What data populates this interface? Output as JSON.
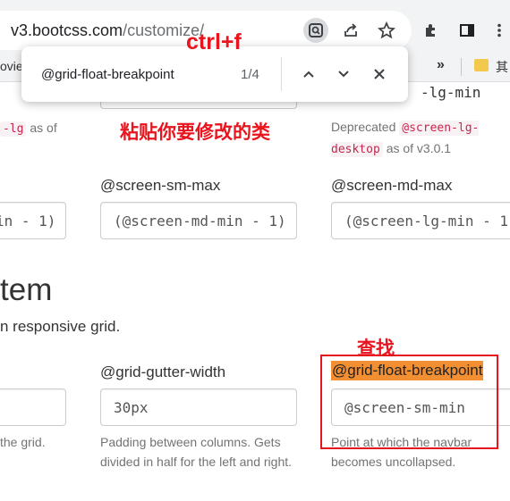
{
  "browser": {
    "url_host": "v3.bootcss.com",
    "url_path": "/customize/",
    "bookmarks_left": "ovie",
    "bookmarks_more": "»",
    "bookmark_folder": "其"
  },
  "findbar": {
    "query": "@grid-float-breakpoint",
    "count": "1/4"
  },
  "annotations": {
    "shortcut": "ctrl+f",
    "paste": "粘贴你要修改的类",
    "search": "查找"
  },
  "page": {
    "top_row": {
      "col1_help_code": "-lg",
      "col1_help_text": "as of",
      "col3_label_partial": "-lg-min",
      "col3_help_prefix": "Deprecated",
      "col3_help_code": "@screen-lg-desktop",
      "col3_help_suffix": "as of v3.0.1"
    },
    "screen_row": {
      "col1_value": "in - 1)",
      "col2_label": "@screen-sm-max",
      "col2_value": "(@screen-md-min - 1)",
      "col3_label": "@screen-md-max",
      "col3_value": "(@screen-lg-min - 1)"
    },
    "section_title": "tem",
    "section_lead": "n responsive grid.",
    "grid_row": {
      "col1_help": "the grid.",
      "col2_label": "@grid-gutter-width",
      "col2_value": "30px",
      "col2_help": "Padding between columns. Gets divided in half for the left and right.",
      "col3_label": "@grid-float-breakpoint",
      "col3_value": "@screen-sm-min",
      "col3_help": "Point at which the navbar becomes uncollapsed."
    }
  },
  "colors": {
    "annotation_red": "#e8141e",
    "find_highlight": "#f28f33",
    "code_pink": "#c7254e"
  },
  "icons": [
    "search-page-icon",
    "share-icon",
    "bookmark-star-icon",
    "extensions-icon",
    "sidepanel-icon",
    "menu-icon",
    "chevron-up-icon",
    "chevron-down-icon",
    "close-icon",
    "folder-icon"
  ]
}
